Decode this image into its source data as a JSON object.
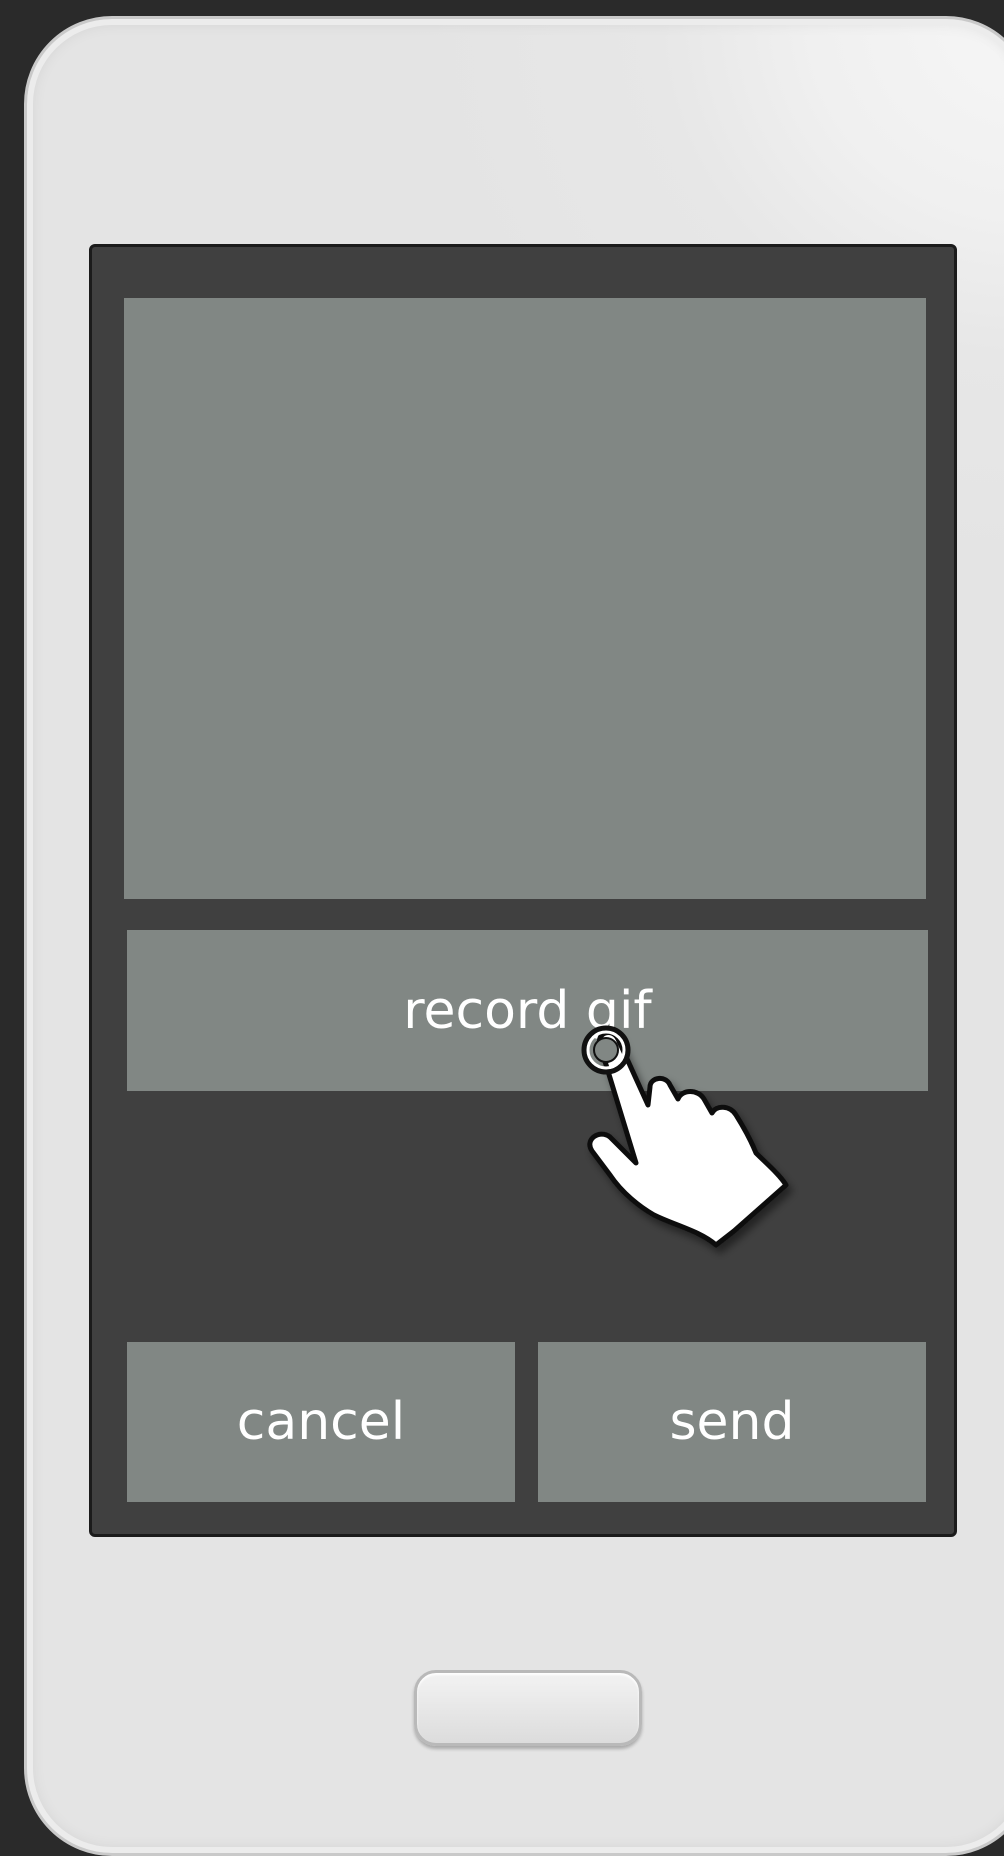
{
  "gif_preview": {},
  "buttons": {
    "record_label": "record gif",
    "cancel_label": "cancel",
    "send_label": "send"
  },
  "icons": {
    "pointer": "hand-tap-icon",
    "home": "home-button"
  },
  "colors": {
    "screen_bg": "#404040",
    "button_bg": "#818784",
    "button_text": "#ffffff",
    "phone_body": "#e6e6e6",
    "outer_bg": "#2a2a2a"
  }
}
